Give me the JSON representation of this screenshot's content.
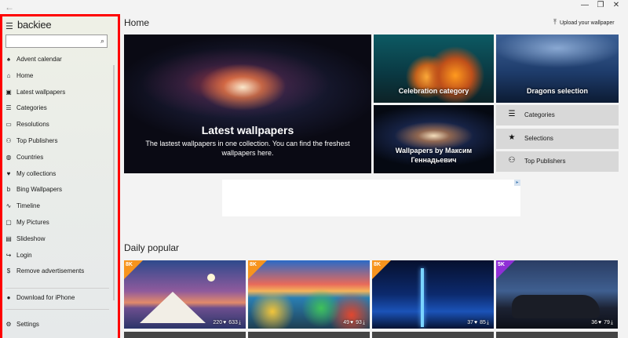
{
  "window": {
    "back_glyph": "←",
    "minimize_glyph": "—",
    "restore_glyph": "❐",
    "close_glyph": "✕"
  },
  "sidebar": {
    "app_name": "backiee",
    "search": {
      "value": "",
      "placeholder": ""
    },
    "items": [
      {
        "label": "Advent calendar",
        "icon": "tree-icon",
        "glyph": "♠"
      },
      {
        "label": "Home",
        "icon": "home-icon",
        "glyph": "⌂"
      },
      {
        "label": "Latest wallpapers",
        "icon": "image-icon",
        "glyph": "▣"
      },
      {
        "label": "Categories",
        "icon": "list-icon",
        "glyph": "☰"
      },
      {
        "label": "Resolutions",
        "icon": "monitor-icon",
        "glyph": "▭"
      },
      {
        "label": "Top Publishers",
        "icon": "users-icon",
        "glyph": "⚇"
      },
      {
        "label": "Countries",
        "icon": "globe-icon",
        "glyph": "◍"
      },
      {
        "label": "My collections",
        "icon": "heart-icon",
        "glyph": "♥"
      },
      {
        "label": "Bing Wallpapers",
        "icon": "bing-icon",
        "glyph": "b"
      },
      {
        "label": "Timeline",
        "icon": "timeline-icon",
        "glyph": "∿"
      },
      {
        "label": "My Pictures",
        "icon": "pictures-icon",
        "glyph": "▢"
      },
      {
        "label": "Slideshow",
        "icon": "slideshow-icon",
        "glyph": "▤"
      },
      {
        "label": "Login",
        "icon": "login-icon",
        "glyph": "↪"
      },
      {
        "label": "Remove advertisements",
        "icon": "dollar-icon",
        "glyph": "$"
      }
    ],
    "download_label": "Download for iPhone",
    "download_glyph": "●",
    "settings_label": "Settings",
    "settings_glyph": "⚙"
  },
  "main": {
    "title": "Home",
    "upload_label": "Upload your wallpaper",
    "upload_glyph": "⤒",
    "featured": {
      "latest_title": "Latest wallpapers",
      "latest_desc": "The lastest wallpapers in one collection. You can find the freshest wallpapers here.",
      "celebration": "Celebration category",
      "dragons": "Dragons selection",
      "maksim": "Wallpapers by Максим Геннадьевич"
    },
    "quick_links": [
      {
        "label": "Categories",
        "icon": "list-icon",
        "glyph": "☰"
      },
      {
        "label": "Selections",
        "icon": "star-icon",
        "glyph": "★"
      },
      {
        "label": "Top Publishers",
        "icon": "users-icon",
        "glyph": "⚇"
      }
    ],
    "ad_badge": "▸",
    "daily_title": "Daily popular",
    "wallpapers": [
      {
        "res": "8K",
        "likes": "220",
        "downloads": "633",
        "badge_color": "#f7941d"
      },
      {
        "res": "8K",
        "likes": "49",
        "downloads": "93",
        "badge_color": "#f7941d"
      },
      {
        "res": "8K",
        "likes": "37",
        "downloads": "85",
        "badge_color": "#f7941d"
      },
      {
        "res": "5K",
        "likes": "36",
        "downloads": "79",
        "badge_color": "#8f2fd6"
      }
    ],
    "like_glyph": "♥",
    "download_glyph": "⤓"
  },
  "colors": {
    "highlight_border": "#ff0000",
    "sidebar_bg": "#eceee8",
    "quick_link_bg": "#d8d8d8"
  }
}
